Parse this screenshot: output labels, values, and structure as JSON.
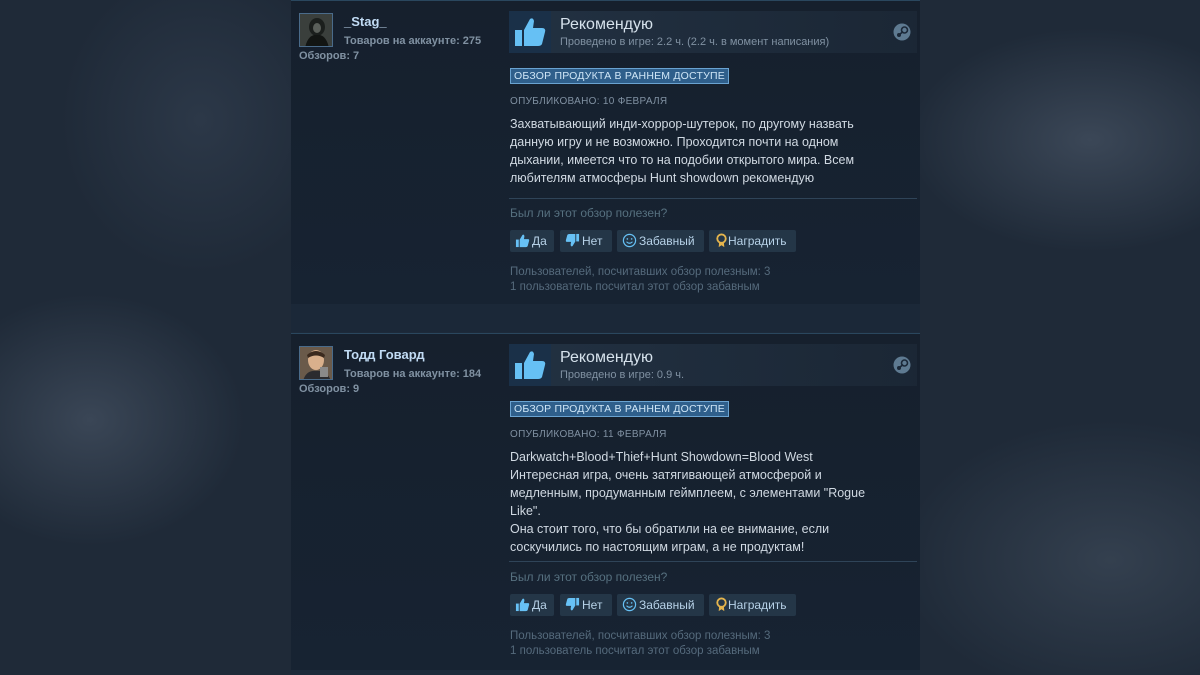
{
  "reviews": [
    {
      "author": "_Stag_",
      "products": "Товаров на аккаунте: 275",
      "reviews_count": "Обзоров: 7",
      "verdict": "Рекомендую",
      "hours": "Проведено в игре: 2.2 ч. (2.2 ч. в момент написания)",
      "badge": "ОБЗОР ПРОДУКТА В РАННЕМ ДОСТУПЕ",
      "posted": "ОПУБЛИКОВАНО: 10 ФЕВРАЛЯ",
      "text": [
        "Захватывающий инди-хоррор-шутерок, по другому назвать",
        "данную игру и не возможно. Проходится почти на одном",
        "дыхании, имеется что то на подобии открытого мира. Всем",
        "любителям атмосферы Hunt showdown рекомендую"
      ],
      "helpful_question": "Был ли этот обзор полезен?",
      "buttons": {
        "yes": "Да",
        "no": "Нет",
        "funny": "Забавный",
        "award": "Наградить"
      },
      "stats": [
        "Пользователей, посчитавших обзор полезным: 3",
        "1 пользователь посчитал этот обзор забавным"
      ]
    },
    {
      "author": "Тодд Говард",
      "products": "Товаров на аккаунте: 184",
      "reviews_count": "Обзоров: 9",
      "verdict": "Рекомендую",
      "hours": "Проведено в игре: 0.9 ч.",
      "badge": "ОБЗОР ПРОДУКТА В РАННЕМ ДОСТУПЕ",
      "posted": "ОПУБЛИКОВАНО: 11 ФЕВРАЛЯ",
      "text": [
        "Darkwatch+Blood+Thief+Hunt Showdown=Blood West",
        "Интересная игра, очень затягивающей атмосферой и",
        "медленным, продуманным геймплеем, с элементами \"Rogue",
        "Like\".",
        "Она стоит того, что бы обратили на ее внимание, если",
        "соскучились по настоящим играм, а не продуктам!"
      ],
      "helpful_question": "Был ли этот обзор полезен?",
      "buttons": {
        "yes": "Да",
        "no": "Нет",
        "funny": "Забавный",
        "award": "Наградить"
      },
      "stats": [
        "Пользователей, посчитавших обзор полезным: 3",
        "1 пользователь посчитал этот обзор забавным"
      ]
    }
  ],
  "icons": {
    "thumb": "thumbs-up-icon",
    "steam": "steam-icon",
    "yes": "thumbs-up-icon",
    "no": "thumbs-down-icon",
    "funny": "smile-icon",
    "award": "award-icon"
  },
  "colors": {
    "thumb_blue": "#66c0f4",
    "award_gold": "#e5b54d",
    "badge_bg": "#2f5f8b"
  }
}
